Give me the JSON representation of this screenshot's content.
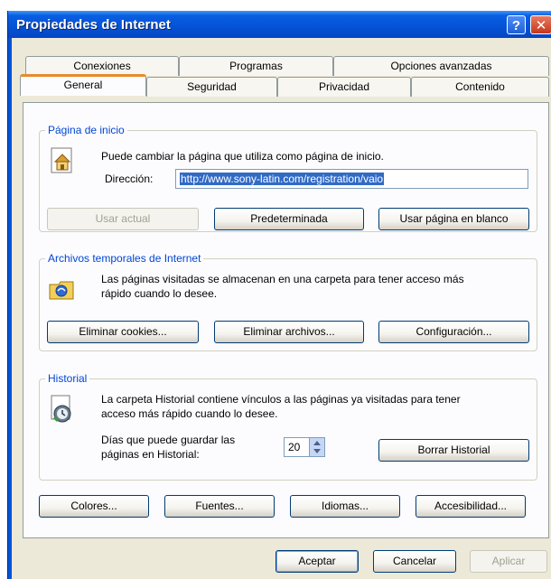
{
  "window": {
    "title": "Propiedades de Internet",
    "help_glyph": "?",
    "close_glyph": "✕"
  },
  "tabs_back": [
    "Conexiones",
    "Programas",
    "Opciones avanzadas"
  ],
  "tabs_front": [
    "General",
    "Seguridad",
    "Privacidad",
    "Contenido"
  ],
  "active_tab": "General",
  "home_page": {
    "legend": "Página de inicio",
    "description": "Puede cambiar la página que utiliza como página de inicio.",
    "address_label": "Dirección:",
    "address_value": "http://www.sony-latin.com/registration/vaio",
    "use_current": "Usar actual",
    "use_default": "Predeterminada",
    "use_blank": "Usar página en blanco"
  },
  "temp_files": {
    "legend": "Archivos temporales de Internet",
    "description_line1": "Las páginas visitadas se almacenan en una carpeta para tener acceso más",
    "description_line2": "rápido cuando lo desee.",
    "delete_cookies": "Eliminar cookies...",
    "delete_files": "Eliminar archivos...",
    "settings": "Configuración..."
  },
  "history": {
    "legend": "Historial",
    "description_line1": "La carpeta Historial contiene vínculos a las páginas ya visitadas para tener",
    "description_line2": "acceso más rápido cuando lo desee.",
    "days_label_line1": "Días que puede guardar las",
    "days_label_line2": "páginas en Historial:",
    "days_value": "20",
    "clear_history": "Borrar Historial"
  },
  "bottom_buttons": {
    "colors": "Colores...",
    "fonts": "Fuentes...",
    "languages": "Idiomas...",
    "accessibility": "Accesibilidad..."
  },
  "dialog_buttons": {
    "ok": "Aceptar",
    "cancel": "Cancelar",
    "apply": "Aplicar"
  },
  "colors": {
    "titlebar": "#0454d8",
    "dialog_bg": "#ece9d8",
    "legend_text": "#0046d5",
    "active_tab_accent": "#e68b2c",
    "selection": "#316ac5"
  },
  "icons": {
    "home_page": "home-page-icon",
    "temp_files": "temp-files-icon",
    "history": "history-icon"
  }
}
